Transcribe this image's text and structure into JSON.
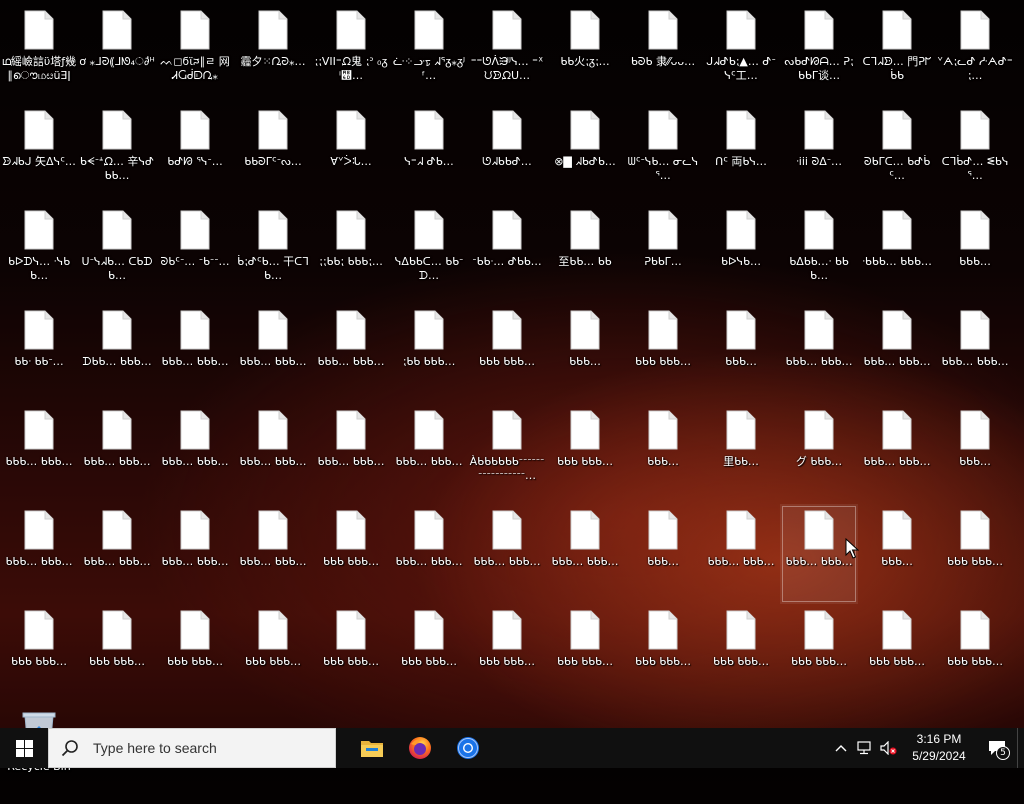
{
  "desktop": {
    "icons": [
      {
        "label": "ഥ䌊嶮誩ϋ塔ƒ幾 ∥ൌமೞüƎǀ"
      },
      {
        "label": "ơ ⁎ᒧᘒ⸨ᒧᘚ₄ൎ∂ᴴ"
      },
      {
        "label": "ᨓ◻ϭϊᰎ∥ㄹ 网 ᏗႺᑰᗟᘩ⁎"
      },
      {
        "label": "霾夕⁙ᘩᘒ⁎…"
      },
      {
        "label": "⁏⁏VII⁼ᘵ鬼 ⁏ᐣ ₀ᵹⁱ꭭…"
      },
      {
        "label": "ᓩ⁘ᓣᢧ ᖽᕐᵹ⁎ᵹᴶᶠ…"
      },
      {
        "label": "⁼⁼ᘎᐲᙒᴶᴶᓭ… ⁼ᕁᙀᗦᘵᑌ…"
      },
      {
        "label": "ᑲᑲ火⁏ᵹ⁏…"
      },
      {
        "label": "ᑲᘐᑲ 隶⁄⁄ᴗᴗ…"
      },
      {
        "label": "ᒍᖽᕷᑲ⁏▲… ᕷᐨᓭᑦ工…"
      },
      {
        "label": "ᔓᑲᕷᘙᗩ… ᕈ⁏ᑲᑲᒥ谈…"
      },
      {
        "label": "ᑕᒣᖽᗦ… 門ᕈᖸᑳᑲ"
      },
      {
        "label": "ᘁᗅ⁏ᓚᕷ ᓽᗅᕷ⁼⁏…"
      },
      {
        "label": "ᗦᖽᑲᒍ 矢ᐃᓭᑦ…"
      },
      {
        "label": "ᑲᗕᐨᗮᘵ… 辛ᓭᕷᑲᑲ…"
      },
      {
        "label": "ᑲᕷᘙ ᕐᓭᐨ…"
      },
      {
        "label": "ᑲᑲᘐᒥᑦᐨᔓ…"
      },
      {
        "label": "∀ᘁᐴᒠ…"
      },
      {
        "label": "ᓭ⁼ᖽ ᕷᑲ…"
      },
      {
        "label": "ᘎᖽᑲᑲᕷ…"
      },
      {
        "label": "⊗▇ ᖽᑲᕷᑲ…"
      },
      {
        "label": "ᗯᑦᐨᓭᑲ… ᓂᓚᓭᕐ…"
      },
      {
        "label": "ᑎᑦ 両ᑲᓭ…"
      },
      {
        "label": "ᐧiii ᘐᐃᐨ…"
      },
      {
        "label": "ᘐᑲᒥᑕ… ᑲᕷᑳᑦ…"
      },
      {
        "label": "ᑕᒣᑳᕷ… ᓬᑲᓭᕐ…"
      },
      {
        "label": "ᑲᐅᗪᓭ… ᐧᓭᑲᑲ…"
      },
      {
        "label": "ᑌᐨᓭᖽᑲ… ᑕᑲᗪᑲ…"
      },
      {
        "label": "ᘐᑲᑦᐨ… ᐨᑲᐨᐨ…"
      },
      {
        "label": "ᑳ⁏ᕷᑦᑲ… 干ᑕᒣᑲ…"
      },
      {
        "label": "⁏⁏ᑲᑲ⁏ ᑲᑲᑲ⁏…"
      },
      {
        "label": "ᓭᐃᑲᑲᑕ… ᑲᑲᐨᗪ…"
      },
      {
        "label": "ᐨᑲᑲᐧ… ᕷᑲᑲ…"
      },
      {
        "label": "至ᑲᑲ… ᑲᑲ"
      },
      {
        "label": "ᕈᑲᑲᒥ…"
      },
      {
        "label": "ᑲᐅᓭᑲ…"
      },
      {
        "label": "ᑲᐃᑲᑲ…ᐧ ᑲᑲᑲ…"
      },
      {
        "label": "ᐧᑲᑲᑲ… ᑲᑲᑲ…"
      },
      {
        "label": "ᑲᑲᑲ…"
      },
      {
        "label": "ᑲᑲᐧ ᑲᑲᐨ…"
      },
      {
        "label": "ᗪᑲᑲ… ᑲᑲᑲ…"
      },
      {
        "label": "ᑲᑲᑲ… ᑲᑲᑲ…"
      },
      {
        "label": "ᑲᑲᑲ… ᑲᑲᑲ…"
      },
      {
        "label": "ᑲᑲᑲ… ᑲᑲᑲ…"
      },
      {
        "label": "⁏ᑲᑲ ᑲᑲᑲ…"
      },
      {
        "label": "ᑲᑲᑲ ᑲᑲᑲ…"
      },
      {
        "label": "ᑲᑲᑲ…"
      },
      {
        "label": "ᑲᑲᑲ ᑲᑲᑲ…"
      },
      {
        "label": "ᑲᑲᑲ…"
      },
      {
        "label": "ᑲᑲᑲ… ᑲᑲᑲ…"
      },
      {
        "label": "ᑲᑲᑲ… ᑲᑲᑲ…"
      },
      {
        "label": "ᑲᑲᑲ… ᑲᑲᑲ…"
      },
      {
        "label": "ᑲᑲᑲ… ᑲᑲᑲ…"
      },
      {
        "label": "ᑲᑲᑲ… ᑲᑲᑲ…"
      },
      {
        "label": "ᑲᑲᑲ… ᑲᑲᑲ…"
      },
      {
        "label": "ᑲᑲᑲ… ᑲᑲᑲ…"
      },
      {
        "label": "ᑲᑲᑲ… ᑲᑲᑲ…"
      },
      {
        "label": "ᑲᑲᑲ… ᑲᑲᑲ…"
      },
      {
        "label": "Àᑲᑲᑲᑲᑲᑲᐨᐨᐨᐨᐨᐨᐨᐨᐨᐨᐨᐨᐨᐨᐨᐨᐨ…"
      },
      {
        "label": "ᑲᑲᑲ ᑲᑲᑲ…"
      },
      {
        "label": "ᑲᑲᑲ…"
      },
      {
        "label": "里ᑲᑲ…"
      },
      {
        "label": "グ ᑲᑲᑲ…"
      },
      {
        "label": "ᑲᑲᑲ… ᑲᑲᑲ…"
      },
      {
        "label": "ᑲᑲᑲ…"
      },
      {
        "label": "ᑲᑲᑲ… ᑲᑲᑲ…"
      },
      {
        "label": "ᑲᑲᑲ… ᑲᑲᑲ…"
      },
      {
        "label": "ᑲᑲᑲ… ᑲᑲᑲ…"
      },
      {
        "label": "ᑲᑲᑲ… ᑲᑲᑲ…"
      },
      {
        "label": "ᑲᑲᑲ ᑲᑲᑲ…"
      },
      {
        "label": "ᑲᑲᑲ… ᑲᑲᑲ…"
      },
      {
        "label": "ᑲᑲᑲ… ᑲᑲᑲ…"
      },
      {
        "label": "ᑲᑲᑲ… ᑲᑲᑲ…"
      },
      {
        "label": "ᑲᑲᑲ…"
      },
      {
        "label": "ᑲᑲᑲ… ᑲᑲᑲ…"
      },
      {
        "label": "ᑲᑲᑲ… ᑲᑲᑲ…"
      },
      {
        "label": "ᑲᑲᑲ…"
      },
      {
        "label": "ᑲᑲᑲ ᑲᑲᑲ…"
      },
      {
        "label": "ᑲᑲᑲ ᑲᑲᑲ…"
      },
      {
        "label": "ᑲᑲᑲ ᑲᑲᑲ…"
      },
      {
        "label": "ᑲᑲᑲ ᑲᑲᑲ…"
      },
      {
        "label": "ᑲᑲᑲ ᑲᑲᑲ…"
      },
      {
        "label": "ᑲᑲᑲ ᑲᑲᑲ…"
      },
      {
        "label": "ᑲᑲᑲ ᑲᑲᑲ…"
      },
      {
        "label": "ᑲᑲᑲ ᑲᑲᑲ…"
      },
      {
        "label": "ᑲᑲᑲ ᑲᑲᑲ…"
      },
      {
        "label": "ᑲᑲᑲ ᑲᑲᑲ…"
      },
      {
        "label": "ᑲᑲᑲ ᑲᑲᑲ…"
      },
      {
        "label": "ᑲᑲᑲ ᑲᑲᑲ…"
      },
      {
        "label": "ᑲᑲᑲ ᑲᑲᑲ…"
      },
      {
        "label": "ᑲᑲᑲ ᑲᑲᑲ…"
      }
    ],
    "recycle_bin_label": "Recycle Bin",
    "selected_index": 75
  },
  "taskbar": {
    "search_placeholder": "Type here to search",
    "apps": [
      {
        "name": "file-explorer-icon"
      },
      {
        "name": "firefox-icon"
      },
      {
        "name": "chrome-icon"
      }
    ],
    "time": "3:16 PM",
    "date": "5/29/2024",
    "notification_count": "5"
  },
  "colors": {
    "taskbar": "#101010",
    "search_bg": "#f3f3f3",
    "windows_blue": "#0078d7"
  }
}
